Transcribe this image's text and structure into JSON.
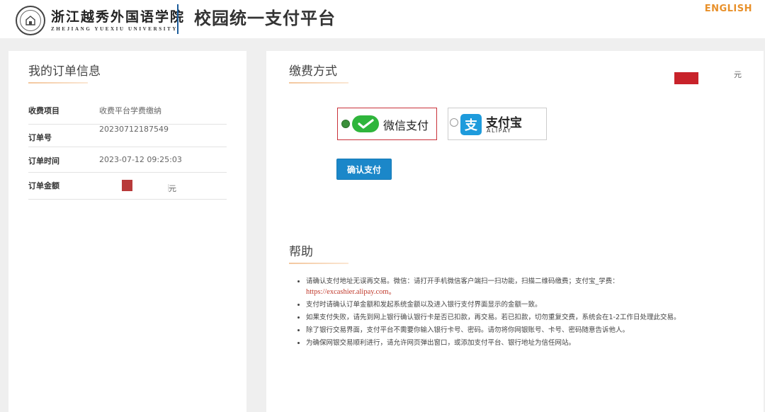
{
  "header": {
    "university_cn": "浙江越秀外国语学院",
    "university_en": "ZHEJIANG YUEXIU UNIVERSITY",
    "platform_title": "校园统一支付平台",
    "language_link": "ENGLISH"
  },
  "order_info": {
    "title": "我的订单信息",
    "rows": [
      {
        "label": "收费项目",
        "value": "收费平台学费缴纳"
      },
      {
        "label": "订单号",
        "value": "20230712187549"
      },
      {
        "label": "订单时间",
        "value": "2023-07-12 09:25:03"
      },
      {
        "label": "订单金额",
        "value": "元"
      }
    ]
  },
  "payment": {
    "title": "缴费方式",
    "amount_unit": "元",
    "options": [
      {
        "label": "微信支付",
        "selected": true,
        "icon": "wechat-pay-icon"
      },
      {
        "label": "支付宝",
        "sublabel": "ALIPAY",
        "selected": false,
        "icon": "alipay-icon"
      }
    ],
    "confirm_label": "确认支付"
  },
  "help": {
    "title": "帮助",
    "items": [
      {
        "text": "请确认支付地址无误再交易。微信：请打开手机微信客户端扫一扫功能，扫描二维码缴费；支付宝_学费：",
        "link": "https://excashier.alipay.com。"
      },
      {
        "text": "支付时请确认订单金额和发起系统金额以及进入银行支付界面显示的金额一致。"
      },
      {
        "text": "如果支付失败，请先到网上银行确认银行卡是否已扣款，再交易。若已扣款，切勿重复交费，系统会在1-2工作日处理此交易。"
      },
      {
        "text": "除了银行交易界面，支付平台不需要你输入银行卡号、密码。请勿将你网银账号、卡号、密码随意告诉他人。"
      },
      {
        "text": "为确保网银交易顺利进行，请允许网页弹出窗口，或添加支付平台、银行地址为信任网站。"
      }
    ]
  },
  "colors": {
    "accent_orange": "#e8902a",
    "confirm_blue": "#1b87c9",
    "selected_border": "#c9323a",
    "wechat_green": "#2fb53c",
    "alipay_blue": "#1e9bdc",
    "redaction": "#b83a3a"
  }
}
